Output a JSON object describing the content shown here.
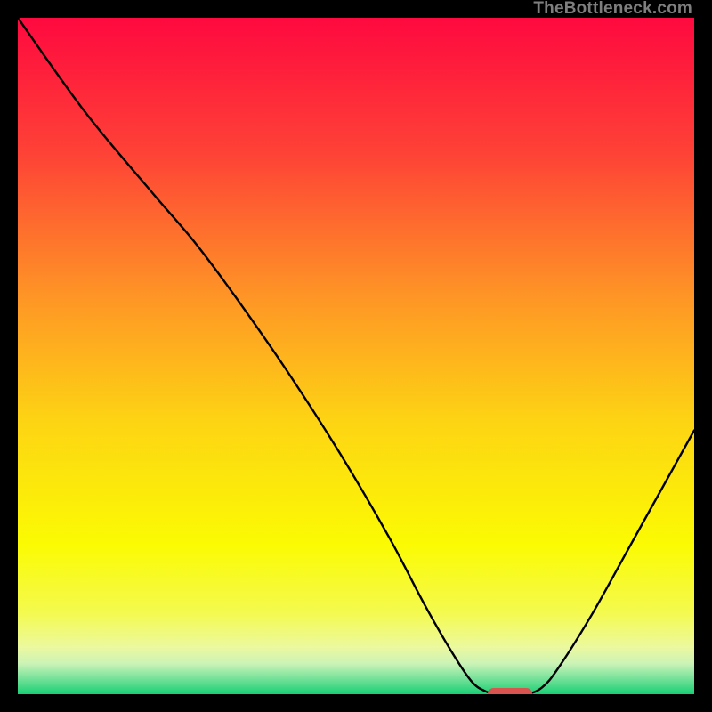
{
  "watermark": {
    "text": "TheBottleneck.com"
  },
  "chart_data": {
    "type": "line",
    "title": "",
    "xlabel": "",
    "ylabel": "",
    "xlim": [
      0,
      100
    ],
    "ylim": [
      0,
      100
    ],
    "grid": false,
    "legend": false,
    "gradient_stops": [
      {
        "pos": 0.0,
        "color": "#fe093f"
      },
      {
        "pos": 0.2,
        "color": "#fe4236"
      },
      {
        "pos": 0.42,
        "color": "#fe9825"
      },
      {
        "pos": 0.6,
        "color": "#fdd513"
      },
      {
        "pos": 0.78,
        "color": "#fbfb03"
      },
      {
        "pos": 0.88,
        "color": "#f4fa4f"
      },
      {
        "pos": 0.93,
        "color": "#ecf99e"
      },
      {
        "pos": 0.955,
        "color": "#cbf3b7"
      },
      {
        "pos": 0.975,
        "color": "#7de39c"
      },
      {
        "pos": 1.0,
        "color": "#19cf75"
      }
    ],
    "series": [
      {
        "name": "bottleneck-curve",
        "color": "#000000",
        "width": 2.4,
        "points": [
          {
            "x": 0.0,
            "y": 100.0
          },
          {
            "x": 10.0,
            "y": 86.0
          },
          {
            "x": 20.0,
            "y": 74.0
          },
          {
            "x": 26.0,
            "y": 67.0
          },
          {
            "x": 32.0,
            "y": 59.0
          },
          {
            "x": 40.0,
            "y": 47.5
          },
          {
            "x": 48.0,
            "y": 35.0
          },
          {
            "x": 55.0,
            "y": 23.0
          },
          {
            "x": 60.0,
            "y": 13.5
          },
          {
            "x": 64.0,
            "y": 6.5
          },
          {
            "x": 67.0,
            "y": 2.0
          },
          {
            "x": 69.0,
            "y": 0.5
          },
          {
            "x": 71.0,
            "y": 0.0
          },
          {
            "x": 75.0,
            "y": 0.0
          },
          {
            "x": 77.5,
            "y": 1.0
          },
          {
            "x": 80.0,
            "y": 4.0
          },
          {
            "x": 85.0,
            "y": 12.0
          },
          {
            "x": 90.0,
            "y": 21.0
          },
          {
            "x": 95.0,
            "y": 30.0
          },
          {
            "x": 100.0,
            "y": 39.0
          }
        ]
      }
    ],
    "marker": {
      "name": "optimal-zone",
      "color": "#d9544f",
      "x_start": 69.5,
      "x_end": 76.0,
      "y": 0.0
    }
  }
}
